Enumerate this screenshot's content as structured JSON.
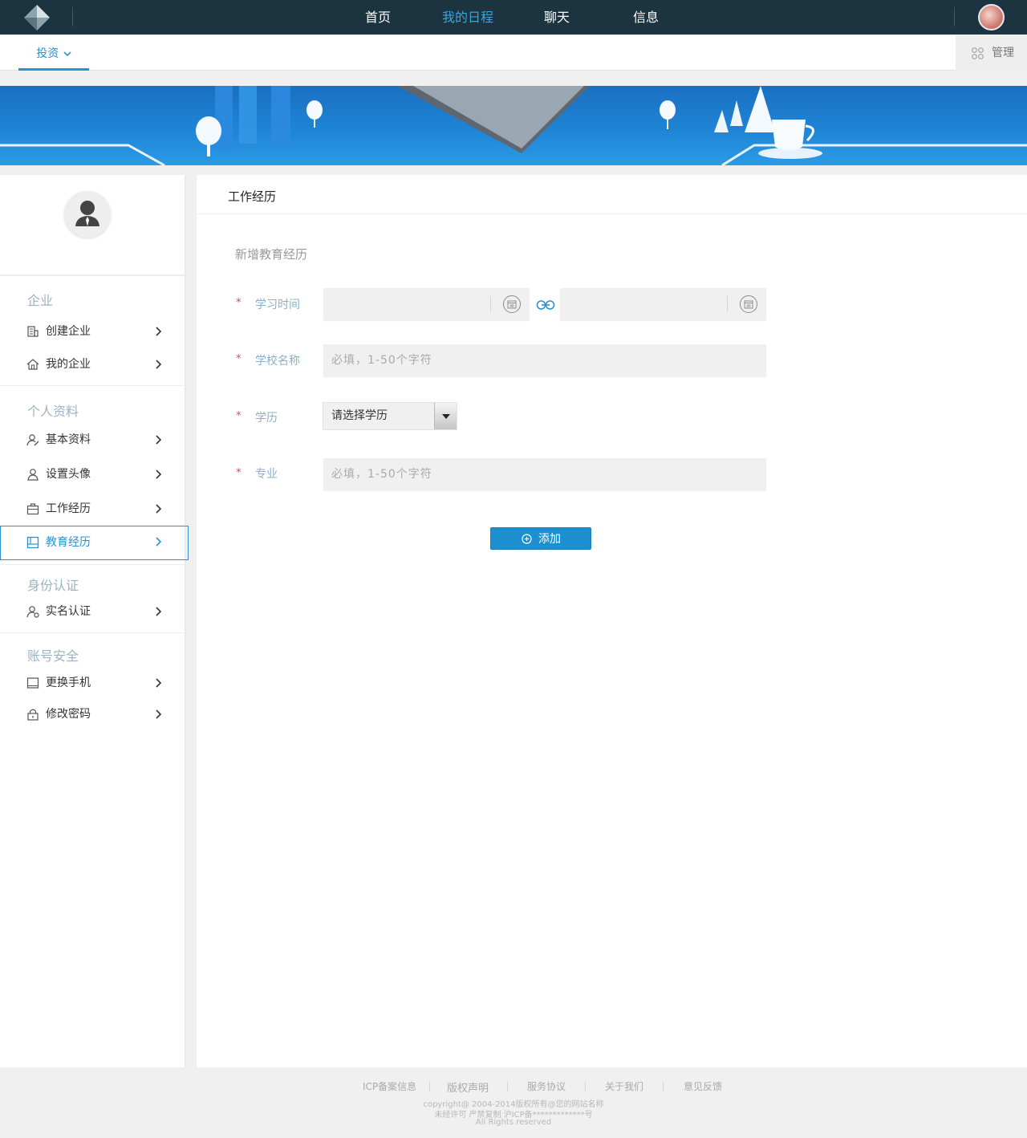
{
  "topnav": {
    "items": [
      "首页",
      "我的日程",
      "聊天",
      "信息"
    ],
    "active_index": 1
  },
  "subnav": {
    "tab_label": "投资",
    "manage_label": "管理"
  },
  "sidebar": {
    "groups": [
      {
        "title": "企业",
        "items": [
          {
            "label": "创建企业",
            "icon": "building-icon"
          },
          {
            "label": "我的企业",
            "icon": "home-icon"
          }
        ]
      },
      {
        "title": "个人资料",
        "items": [
          {
            "label": "基本资料",
            "icon": "user-edit-icon"
          },
          {
            "label": "设置头像",
            "icon": "user-icon"
          },
          {
            "label": "工作经历",
            "icon": "briefcase-icon"
          },
          {
            "label": "教育经历",
            "icon": "book-icon"
          }
        ]
      },
      {
        "title": "身份认证",
        "items": [
          {
            "label": "实名认证",
            "icon": "id-user-icon"
          }
        ]
      },
      {
        "title": "账号安全",
        "items": [
          {
            "label": "更换手机",
            "icon": "tablet-icon"
          },
          {
            "label": "修改密码",
            "icon": "lock-icon"
          }
        ]
      }
    ],
    "active_item": "教育经历"
  },
  "main": {
    "title": "工作经历",
    "section_title": "新增教育经历",
    "required_mark": "*",
    "fields": {
      "study_time": {
        "label": "学习时间",
        "start_value": "",
        "end_value": ""
      },
      "school": {
        "label": "学校名称",
        "placeholder": "必填，1-50个字符"
      },
      "degree": {
        "label": "学历",
        "selected": "请选择学历"
      },
      "major": {
        "label": "专业",
        "placeholder": "必填，1-50个字符"
      }
    },
    "add_button": "添加"
  },
  "footer": {
    "links": [
      "ICP备案信息",
      "版权声明",
      "服务协议",
      "关于我们",
      "意见反馈"
    ],
    "copyright": "copyright@ 2004-2014版权所有@您的网站名称",
    "license": "未经许可 严禁复制 沪ICP备*************号",
    "rights": "All Rights reserved"
  },
  "colors": {
    "topbar": "#1b3440",
    "accent": "#2a93cf",
    "required": "#e84646",
    "button": "#1d8fd0"
  }
}
